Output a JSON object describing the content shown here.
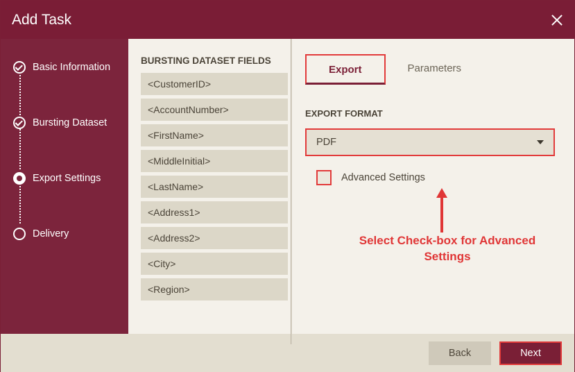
{
  "window": {
    "title": "Add Task"
  },
  "steps": {
    "basic": "Basic Information",
    "bursting": "Bursting Dataset",
    "export": "Export Settings",
    "delivery": "Delivery"
  },
  "fields": {
    "title": "BURSTING DATASET FIELDS",
    "items": [
      "<CustomerID>",
      "<AccountNumber>",
      "<FirstName>",
      "<MiddleInitial>",
      "<LastName>",
      "<Address1>",
      "<Address2>",
      "<City>",
      "<Region>"
    ]
  },
  "tabs": {
    "export": "Export",
    "parameters": "Parameters"
  },
  "export": {
    "format_label": "EXPORT FORMAT",
    "format_value": "PDF",
    "advanced_label": "Advanced Settings"
  },
  "annotation": {
    "text": "Select Check-box for Advanced Settings"
  },
  "footer": {
    "back": "Back",
    "next": "Next"
  },
  "colors": {
    "brand": "#7a1f36",
    "highlight": "#e23a3a"
  }
}
